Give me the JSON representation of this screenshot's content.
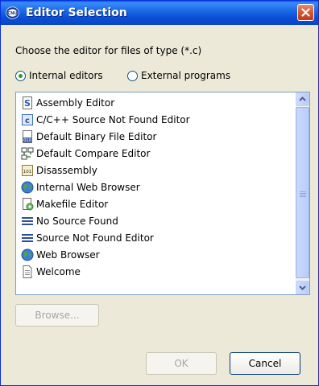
{
  "window": {
    "title": "Editor Selection",
    "app_icon_text": "CNU"
  },
  "prompt": "Choose the editor for files of type (*.c)",
  "radios": [
    {
      "label": "Internal editors",
      "checked": true
    },
    {
      "label": "External programs",
      "checked": false
    }
  ],
  "editors": [
    {
      "label": "Assembly Editor",
      "icon": "assembly-file-icon"
    },
    {
      "label": "C/C++ Source Not Found Editor",
      "icon": "c-file-icon"
    },
    {
      "label": "Default Binary File Editor",
      "icon": "binary-file-icon"
    },
    {
      "label": "Default Compare Editor",
      "icon": "compare-icon"
    },
    {
      "label": "Disassembly",
      "icon": "disassembly-icon"
    },
    {
      "label": "Internal Web Browser",
      "icon": "globe-icon"
    },
    {
      "label": "Makefile Editor",
      "icon": "makefile-icon"
    },
    {
      "label": "No Source Found",
      "icon": "lines-icon"
    },
    {
      "label": "Source Not Found Editor",
      "icon": "lines-icon"
    },
    {
      "label": "Web Browser",
      "icon": "globe-icon"
    },
    {
      "label": "Welcome",
      "icon": "document-icon"
    }
  ],
  "buttons": {
    "browse": "Browse...",
    "ok": "OK",
    "cancel": "Cancel"
  },
  "colors": {
    "titlebar": "#0a58e0",
    "dialog_bg": "#ece9d8",
    "close": "#d7572f"
  }
}
